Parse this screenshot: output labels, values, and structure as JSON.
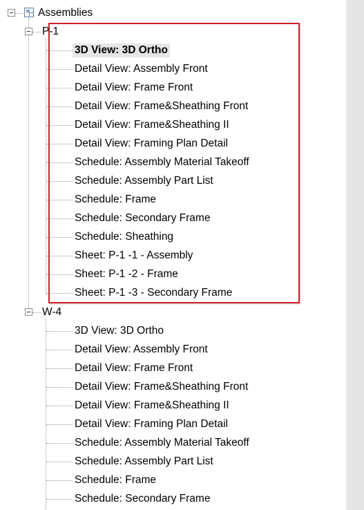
{
  "tree": {
    "root": {
      "label": "Assemblies",
      "icon": "assembly-icon"
    },
    "groups": [
      {
        "label": "P-1",
        "selected_index": 0,
        "items": [
          "3D View: 3D Ortho",
          "Detail View: Assembly Front",
          "Detail View: Frame Front",
          "Detail View: Frame&Sheathing Front",
          "Detail View: Frame&Sheathing II",
          "Detail View: Framing Plan Detail",
          "Schedule: Assembly Material Takeoff",
          "Schedule: Assembly Part List",
          "Schedule: Frame",
          "Schedule: Secondary Frame",
          "Schedule: Sheathing",
          "Sheet: P-1 -1 - Assembly",
          "Sheet: P-1 -2 - Frame",
          "Sheet: P-1 -3 - Secondary Frame"
        ]
      },
      {
        "label": "W-4",
        "items": [
          "3D View: 3D Ortho",
          "Detail View: Assembly Front",
          "Detail View: Frame Front",
          "Detail View: Frame&Sheathing Front",
          "Detail View: Frame&Sheathing II",
          "Detail View: Framing Plan Detail",
          "Schedule: Assembly Material Takeoff",
          "Schedule: Assembly Part List",
          "Schedule: Frame",
          "Schedule: Secondary Frame"
        ]
      }
    ]
  },
  "colors": {
    "highlight_border": "#d1202a",
    "selection_bg": "#e5e5e5",
    "scrollbar_bg": "#e6e6e6"
  }
}
